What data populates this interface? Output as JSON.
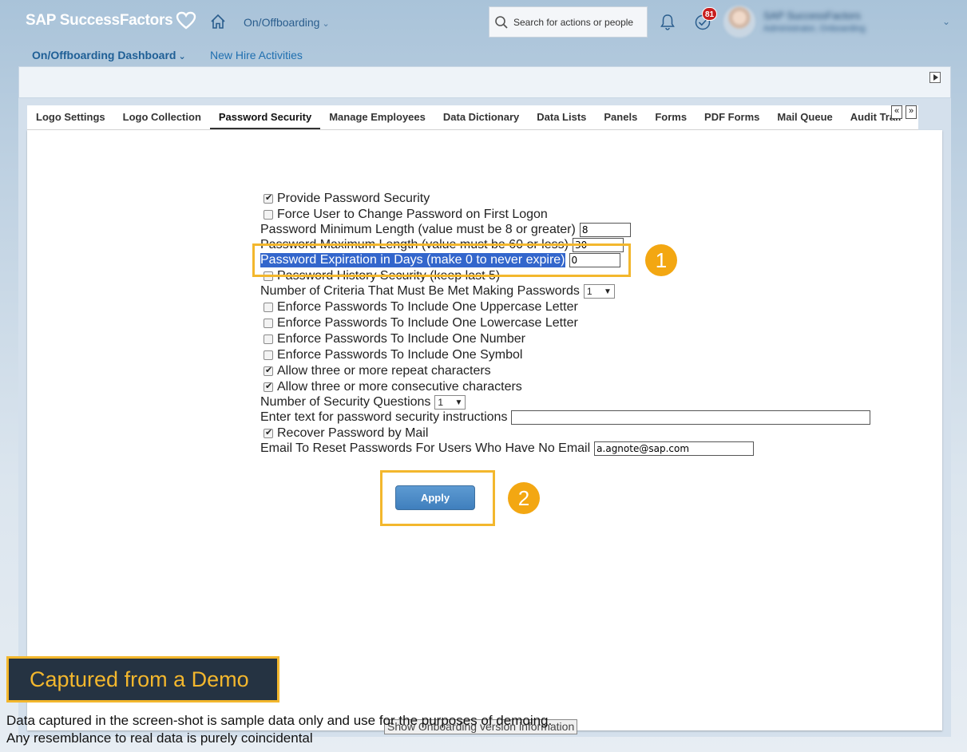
{
  "shell": {
    "logo": "SAP SuccessFactors",
    "module": "On/Offboarding",
    "search_placeholder": "Search for actions or people",
    "todo_badge": "81",
    "user_name": "SAP SuccessFactors",
    "user_title": "Administrator, Onboarding"
  },
  "subnav": {
    "dashboard": "On/Offboarding Dashboard",
    "new_hire": "New Hire Activities"
  },
  "tabs": [
    {
      "label": "Logo Settings"
    },
    {
      "label": "Logo Collection"
    },
    {
      "label": "Password Security"
    },
    {
      "label": "Manage Employees"
    },
    {
      "label": "Data Dictionary"
    },
    {
      "label": "Data Lists"
    },
    {
      "label": "Panels"
    },
    {
      "label": "Forms"
    },
    {
      "label": "PDF Forms"
    },
    {
      "label": "Mail Queue"
    },
    {
      "label": "Audit Trail"
    }
  ],
  "active_tab": "Password Security",
  "tab_scroll": {
    "left": "«",
    "right": "»"
  },
  "form": {
    "provide_security": {
      "label": "Provide Password Security",
      "checked": true
    },
    "force_change": {
      "label": "Force User to Change Password on First Logon",
      "checked": false
    },
    "min_length": {
      "label": "Password Minimum Length (value must be 8 or greater)",
      "value": "8"
    },
    "max_length": {
      "label": "Password Maximum Length (value must be 60 or less)",
      "value": "30"
    },
    "expiration": {
      "label": "Password Expiration in Days (make 0 to never expire)",
      "value": "0"
    },
    "history": {
      "label": "Password History Security (keep last 5)",
      "checked": false
    },
    "criteria": {
      "label": "Number of Criteria That Must Be Met Making Passwords",
      "value": "1"
    },
    "uppercase": {
      "label": "Enforce Passwords To Include One Uppercase Letter",
      "checked": false
    },
    "lowercase": {
      "label": "Enforce Passwords To Include One Lowercase Letter",
      "checked": false
    },
    "number": {
      "label": "Enforce Passwords To Include One Number",
      "checked": false
    },
    "symbol": {
      "label": "Enforce Passwords To Include One Symbol",
      "checked": false
    },
    "repeat": {
      "label": "Allow three or more repeat characters",
      "checked": true
    },
    "consecutive": {
      "label": "Allow three or more consecutive characters",
      "checked": true
    },
    "questions": {
      "label": "Number of Security Questions",
      "value": "1"
    },
    "instructions": {
      "label": "Enter text for password security instructions",
      "value": ""
    },
    "recover": {
      "label": "Recover Password by Mail",
      "checked": true
    },
    "reset_email": {
      "label": "Email To Reset Passwords For Users Who Have No Email",
      "value": "a.agnote@sap.com"
    },
    "apply": "Apply"
  },
  "callouts": [
    "1",
    "2"
  ],
  "tooltip": "Show Onboarding version information",
  "demo": {
    "banner": "Captured from a Demo",
    "line1": "Data captured in the screen-shot is sample data only and use for the purposes of demoing.",
    "line2": "Any resemblance to real data is purely coincidental"
  },
  "colors": {
    "accent": "#f3b72d",
    "badge": "#c81e1e",
    "brand_blue": "#1f5f96"
  }
}
